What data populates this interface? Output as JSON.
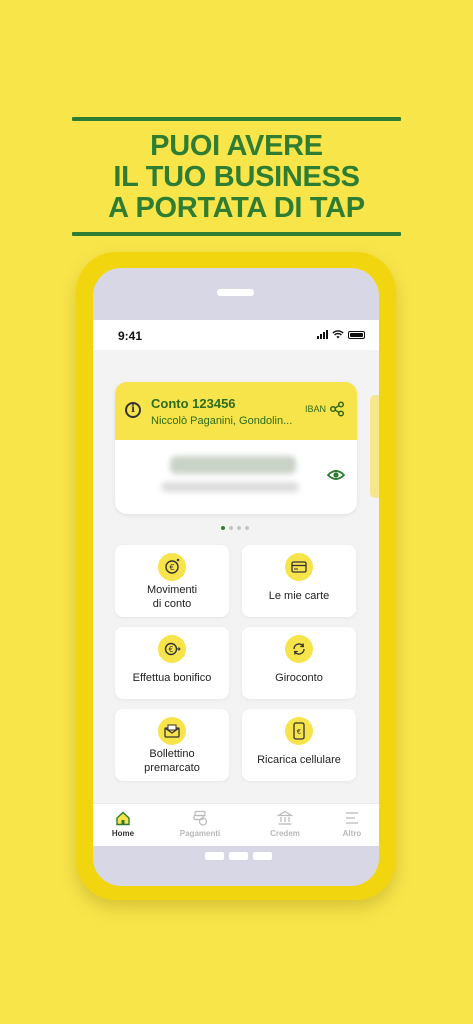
{
  "promo": {
    "headline_lines": [
      "PUOI AVERE",
      "IL TUO BUSINESS",
      "A PORTATA DI TAP"
    ]
  },
  "status_bar": {
    "time": "9:41"
  },
  "account_card": {
    "title": "Conto 123456",
    "holder": "Niccolò Paganini, Gondolin...",
    "iban_label": "IBAN"
  },
  "carousel": {
    "pages": 4,
    "active_index": 0
  },
  "actions": [
    {
      "label_lines": [
        "Movimenti",
        "di conto"
      ],
      "icon": "euro-refresh-icon"
    },
    {
      "label_lines": [
        "Le mie carte"
      ],
      "icon": "card-icon"
    },
    {
      "label_lines": [
        "Effettua bonifico"
      ],
      "icon": "euro-transfer-icon"
    },
    {
      "label_lines": [
        "Giroconto"
      ],
      "icon": "cycle-arrows-icon"
    },
    {
      "label_lines": [
        "Bollettino",
        "premarcato"
      ],
      "icon": "mail-icon"
    },
    {
      "label_lines": [
        "Ricarica cellulare"
      ],
      "icon": "phone-recharge-icon"
    }
  ],
  "tabbar": {
    "items": [
      {
        "label": "Home",
        "active": true
      },
      {
        "label": "Pagamenti",
        "active": false
      },
      {
        "label": "Credem",
        "active": false
      },
      {
        "label": "Altro",
        "active": false
      }
    ]
  },
  "colors": {
    "background": "#f8e54a",
    "brand_green": "#2e7d32",
    "phone_frame": "#f1d60f",
    "accent_yellow": "#f7e34a"
  }
}
